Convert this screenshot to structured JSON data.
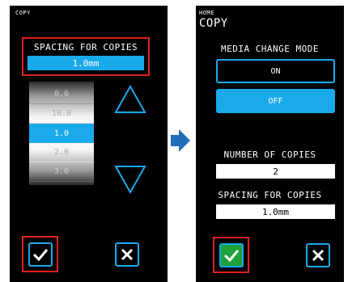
{
  "left": {
    "crumb": "COPY",
    "spacing_label": "SPACING FOR COPIES",
    "spacing_value": "1.0mm",
    "roller_items": [
      "0.0",
      "10.0",
      "1.0",
      "2.0",
      "3.0"
    ]
  },
  "right": {
    "crumb": "HOME",
    "title": "COPY",
    "media_change_label": "MEDIA CHANGE MODE",
    "on_label": "ON",
    "off_label": "OFF",
    "copies_label": "NUMBER OF COPIES",
    "copies_value": "2",
    "spacing_label": "SPACING FOR COPIES",
    "spacing_value": "1.0mm"
  },
  "icons": {
    "up": "triangle-up-icon",
    "down": "triangle-down-icon",
    "confirm": "checkmark-icon",
    "cancel": "close-icon",
    "arrow": "arrow-right-icon"
  },
  "colors": {
    "accent": "#1aa9ea",
    "highlight": "#e0201e",
    "confirm_green": "#1fa23a",
    "arrow": "#1f6fb8"
  }
}
